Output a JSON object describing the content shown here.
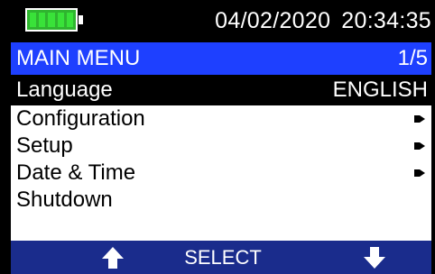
{
  "status": {
    "battery_level": 1.0,
    "date": "04/02/2020",
    "time": "20:34:35"
  },
  "menu": {
    "title": "MAIN MENU",
    "page": "1/5",
    "selected": {
      "label": "Language",
      "value": "ENGLISH"
    },
    "items": [
      {
        "label": "Configuration",
        "submenu": true
      },
      {
        "label": "Setup",
        "submenu": true
      },
      {
        "label": "Date & Time",
        "submenu": true
      },
      {
        "label": "Shutdown",
        "submenu": false
      }
    ]
  },
  "softkeys": {
    "left_icon": "up-arrow-icon",
    "center_label": "SELECT",
    "right_icon": "down-arrow-icon"
  },
  "colors": {
    "header_blue": "#1e40ff",
    "softkey_bar": "#1a2c8c",
    "battery_green": "#39e239",
    "selected_row": "#000000"
  }
}
